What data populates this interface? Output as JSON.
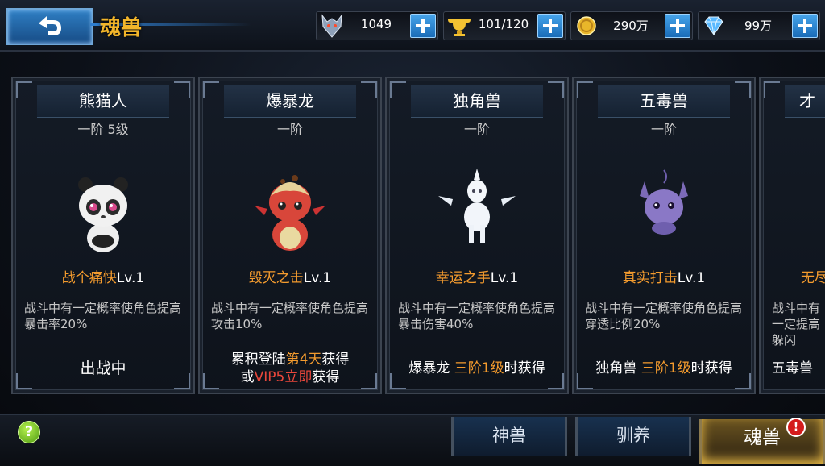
{
  "header": {
    "title": "魂兽"
  },
  "resources": [
    {
      "icon": "wolf-head-icon",
      "value": "1049"
    },
    {
      "icon": "trophy-icon",
      "value": "101/120"
    },
    {
      "icon": "gold-coin-icon",
      "value": "290万"
    },
    {
      "icon": "diamond-icon",
      "value": "99万"
    }
  ],
  "cards": [
    {
      "name": "熊猫人",
      "rank": "一阶 5级",
      "skill_name": "战个痛快",
      "skill_lv": "Lv.1",
      "desc": "战斗中有一定概率使角色提高暴击率20%",
      "status": "出战中"
    },
    {
      "name": "爆暴龙",
      "rank": "一阶",
      "skill_name": "毁灭之击",
      "skill_lv": "Lv.1",
      "desc": "战斗中有一定概率使角色提高攻击10%",
      "cond_a": "累积登陆",
      "cond_b": "第4天",
      "cond_c": "获得",
      "cond_d": "或",
      "cond_e": "VIP5立即",
      "cond_f": "获得"
    },
    {
      "name": "独角兽",
      "rank": "一阶",
      "skill_name": "幸运之手",
      "skill_lv": "Lv.1",
      "desc": "战斗中有一定概率使角色提高暴击伤害40%",
      "cond_a": "爆暴龙 ",
      "cond_b": "三阶1级",
      "cond_c": "时获得"
    },
    {
      "name": "五毒兽",
      "rank": "一阶",
      "skill_name": "真实打击",
      "skill_lv": "Lv.1",
      "desc": "战斗中有一定概率使角色提高穿透比例20%",
      "cond_a": "独角兽 ",
      "cond_b": "三阶1级",
      "cond_c": "时获得"
    },
    {
      "name": "才",
      "skill_name": "无尽",
      "desc": "战斗中有一定提高躲闪",
      "cond_a": "五毒兽 "
    }
  ],
  "bottom": {
    "help": "?",
    "tabs": [
      "神兽",
      "驯养",
      "魂兽"
    ],
    "badge": "!"
  },
  "colors": {
    "accent": "#f39b2e",
    "title": "#f2b52a",
    "button": "#2f7fc4"
  }
}
